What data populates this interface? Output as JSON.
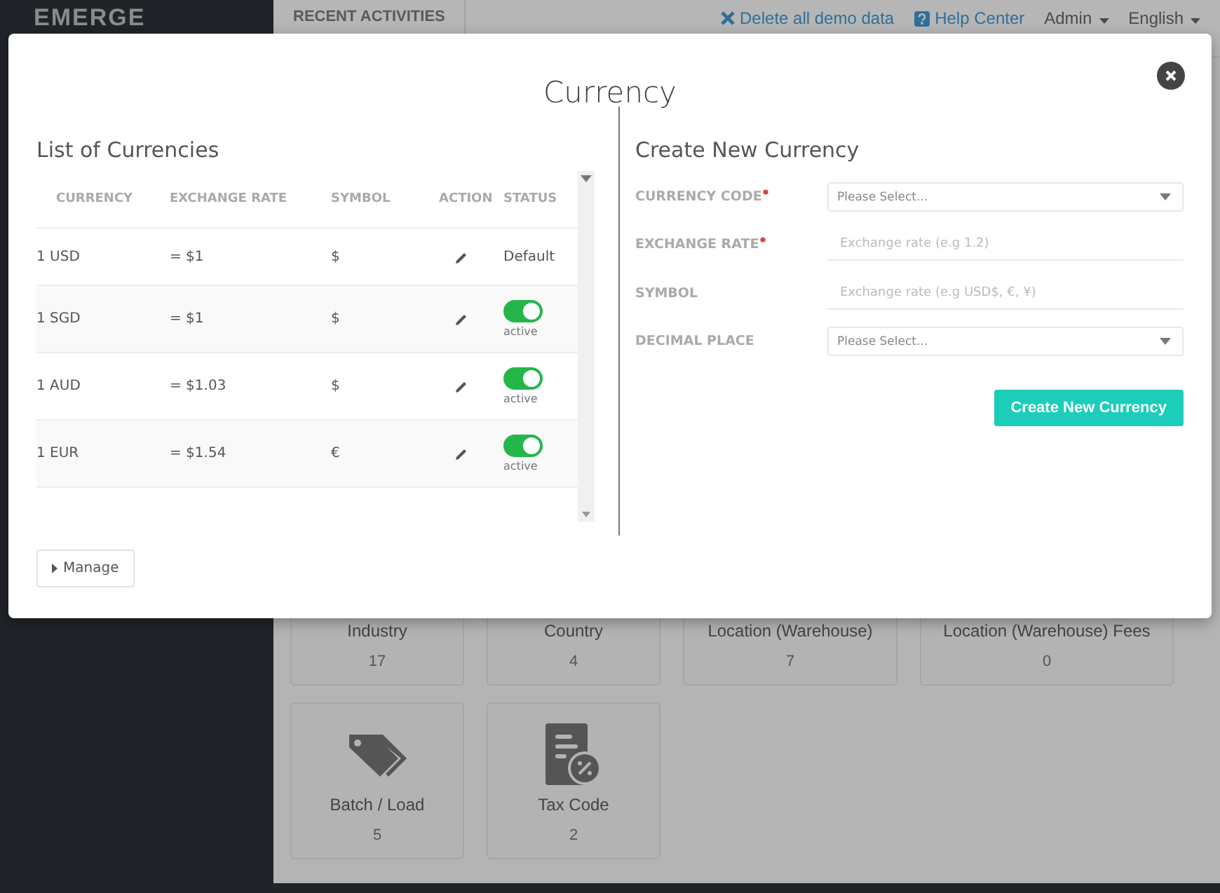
{
  "brand": "EMERGE",
  "header": {
    "section": "RECENT ACTIVITIES",
    "links": [
      {
        "kind": "delete",
        "label": "Delete all demo data"
      },
      {
        "kind": "help",
        "label": "Help Center"
      }
    ],
    "menus": [
      "Admin",
      "English"
    ]
  },
  "cards": [
    {
      "label": "Industry",
      "count": "17",
      "kind": "plain"
    },
    {
      "label": "Country",
      "count": "4",
      "kind": "plain"
    },
    {
      "label": "Location (Warehouse)",
      "count": "7",
      "kind": "plain"
    },
    {
      "label": "Location (Warehouse) Fees",
      "count": "0",
      "kind": "plain"
    },
    {
      "label": "Batch / Load",
      "count": "5",
      "kind": "tags"
    },
    {
      "label": "Tax Code",
      "count": "2",
      "kind": "tax"
    }
  ],
  "modal": {
    "title": "Currency",
    "list": {
      "title": "List of Currencies",
      "columns": [
        "CURRENCY",
        "EXCHANGE RATE",
        "SYMBOL",
        "ACTION",
        "STATUS"
      ],
      "rows": [
        {
          "currency": "1 USD",
          "rate": "= $1",
          "symbol": "$",
          "status": {
            "kind": "text",
            "label": "Default"
          }
        },
        {
          "currency": "1 SGD",
          "rate": "= $1",
          "symbol": "$",
          "status": {
            "kind": "toggle",
            "on": true,
            "label": "active"
          }
        },
        {
          "currency": "1 AUD",
          "rate": "= $1.03",
          "symbol": "$",
          "status": {
            "kind": "toggle",
            "on": true,
            "label": "active"
          }
        },
        {
          "currency": "1 EUR",
          "rate": "= $1.54",
          "symbol": "€",
          "status": {
            "kind": "toggle",
            "on": true,
            "label": "active"
          }
        }
      ],
      "manage_button": "Manage"
    },
    "form": {
      "title": "Create New Currency",
      "fields": [
        {
          "label": "CURRENCY CODE",
          "required": true,
          "kind": "select",
          "placeholder": "Please Select..."
        },
        {
          "label": "EXCHANGE RATE",
          "required": true,
          "kind": "input",
          "placeholder": "Exchange rate (e.g 1.2)"
        },
        {
          "label": "SYMBOL",
          "required": false,
          "kind": "input",
          "placeholder": "Exchange rate (e.g USD$, €, ¥)"
        },
        {
          "label": "DECIMAL PLACE",
          "required": false,
          "kind": "select",
          "placeholder": "Please Select..."
        }
      ],
      "submit": "Create New Currency"
    }
  }
}
